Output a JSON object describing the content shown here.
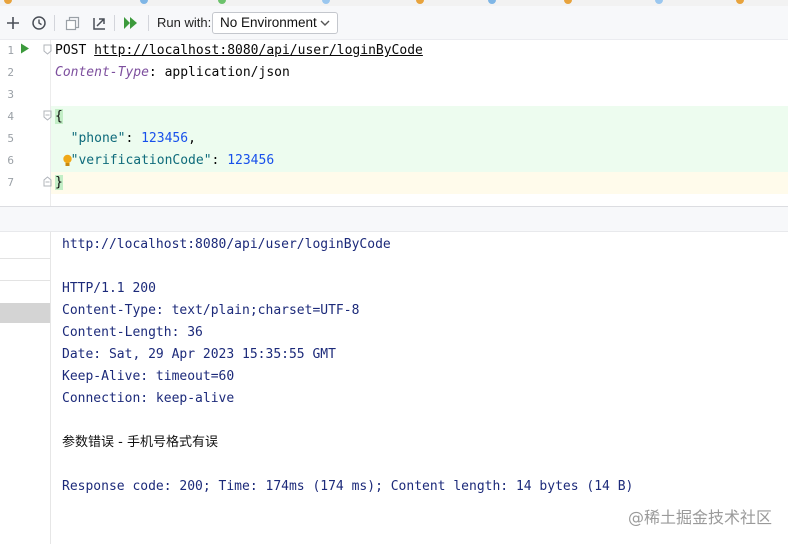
{
  "toolbar": {
    "run_with_label": "Run with:",
    "environment": "No Environment",
    "icons": [
      "add-icon",
      "history-icon",
      "copy-icon",
      "convert-icon",
      "run-all-icon"
    ]
  },
  "editor": {
    "line_numbers": [
      "1",
      "2",
      "3",
      "4",
      "5",
      "6",
      "7"
    ],
    "method": "POST",
    "url": "http://localhost:8080/api/user/loginByCode",
    "header_name": "Content-Type",
    "header_sep": ": ",
    "header_value": "application/json",
    "brace_open": "{",
    "phone_key": "\"phone\"",
    "phone_value": "123456",
    "code_key": "\"verificationCode\"",
    "code_value": "123456",
    "brace_close": "}",
    "colon": ": ",
    "comma": ","
  },
  "response": {
    "lines": [
      "http://localhost:8080/api/user/loginByCode",
      "HTTP/1.1 200",
      "Content-Type: text/plain;charset=UTF-8",
      "Content-Length: 36",
      "Date: Sat, 29 Apr 2023 15:35:55 GMT",
      "Keep-Alive: timeout=60",
      "Connection: keep-alive"
    ],
    "body": "参数错误 - 手机号格式有误",
    "summary": "Response code: 200; Time: 174ms (174 ms); Content length: 14 bytes (14 B)"
  },
  "watermark": "@稀土掘金技术社区",
  "colors": {
    "accent_green": "#3c9a3c",
    "highlight_green": "#edfcef",
    "highlight_yellow": "#fffbeb",
    "response_text": "#1c2a7a",
    "number": "#1750eb",
    "header_name": "#7d4f9e"
  }
}
